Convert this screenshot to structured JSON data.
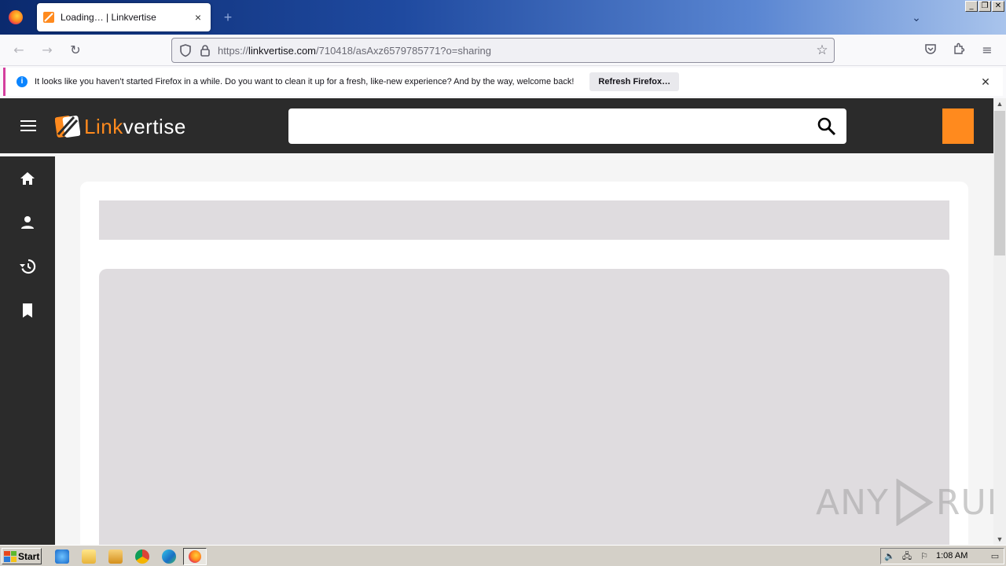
{
  "browser": {
    "tab": {
      "title": "Loading… | Linkvertise",
      "close": "×"
    },
    "new_tab": "+",
    "window_buttons": [
      "_",
      "❐",
      "✕"
    ],
    "url": {
      "prefix": "https://",
      "host": "linkvertise.com",
      "path": "/710418/asAxz6579785771?o=sharing"
    }
  },
  "notification": {
    "text": "It looks like you haven’t started Firefox in a while. Do you want to clean it up for a fresh, like-new experience? And by the way, welcome back!",
    "button": "Refresh Firefox…",
    "close": "✕"
  },
  "site": {
    "brand_accent": "Link",
    "brand_rest": "vertise",
    "accent_color": "#ff8a1e",
    "sidebar": [
      "home-icon",
      "account-icon",
      "history-icon",
      "bookmark-icon"
    ]
  },
  "watermark": {
    "left": "ANY",
    "right": "RUN"
  },
  "taskbar": {
    "start": "Start",
    "clock": "1:08 AM"
  }
}
